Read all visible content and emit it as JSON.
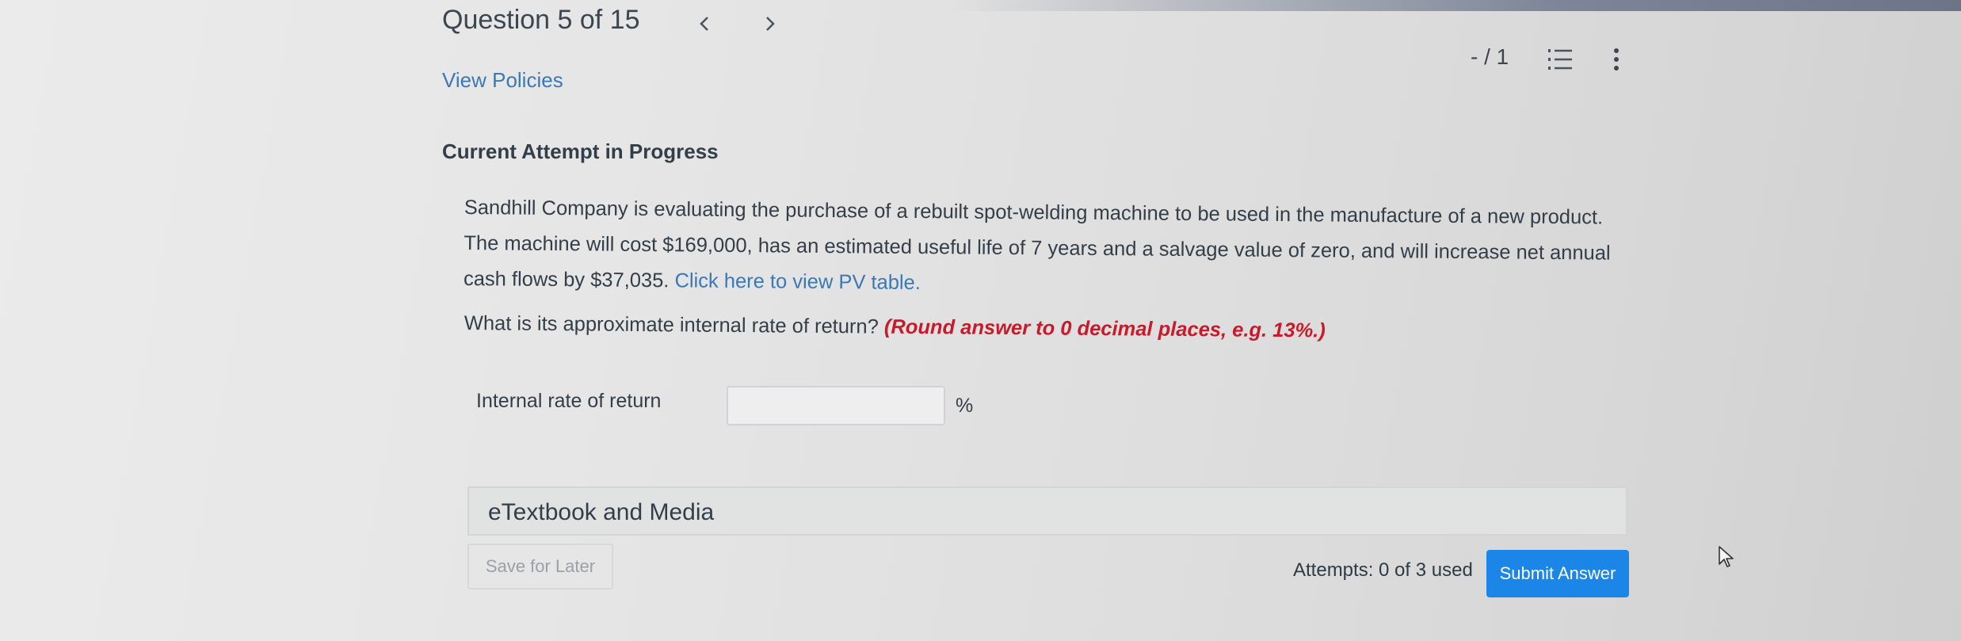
{
  "header": {
    "question_counter": "Question 5 of 15",
    "prev_icon": "chevron-left-icon",
    "next_icon": "chevron-right-icon",
    "view_policies": "View Policies",
    "score": "- / 1",
    "list_icon": "numbered-list-icon",
    "more_icon": "more-vertical-icon"
  },
  "attempt_heading": "Current Attempt in Progress",
  "question": {
    "text": "Sandhill Company is evaluating the purchase of a rebuilt spot-welding machine to be used in the manufacture of a new product. The machine will cost $169,000, has an estimated useful life of 7 years and a salvage value of zero, and will increase net annual cash flows by $37,035. ",
    "pv_link": "Click here to view PV table.",
    "prompt": "What is its approximate internal rate of return? ",
    "hint": "(Round answer to 0 decimal places, e.g. 13%.)"
  },
  "answer": {
    "label": "Internal rate of return",
    "value": "",
    "unit": "%"
  },
  "etextbook": "eTextbook and Media",
  "footer": {
    "save_label": "Save for Later",
    "attempts": "Attempts: 0 of 3 used",
    "submit_label": "Submit Answer"
  },
  "colors": {
    "link": "#3a78b6",
    "hint": "#c81a2a",
    "submit": "#1c86e8"
  }
}
